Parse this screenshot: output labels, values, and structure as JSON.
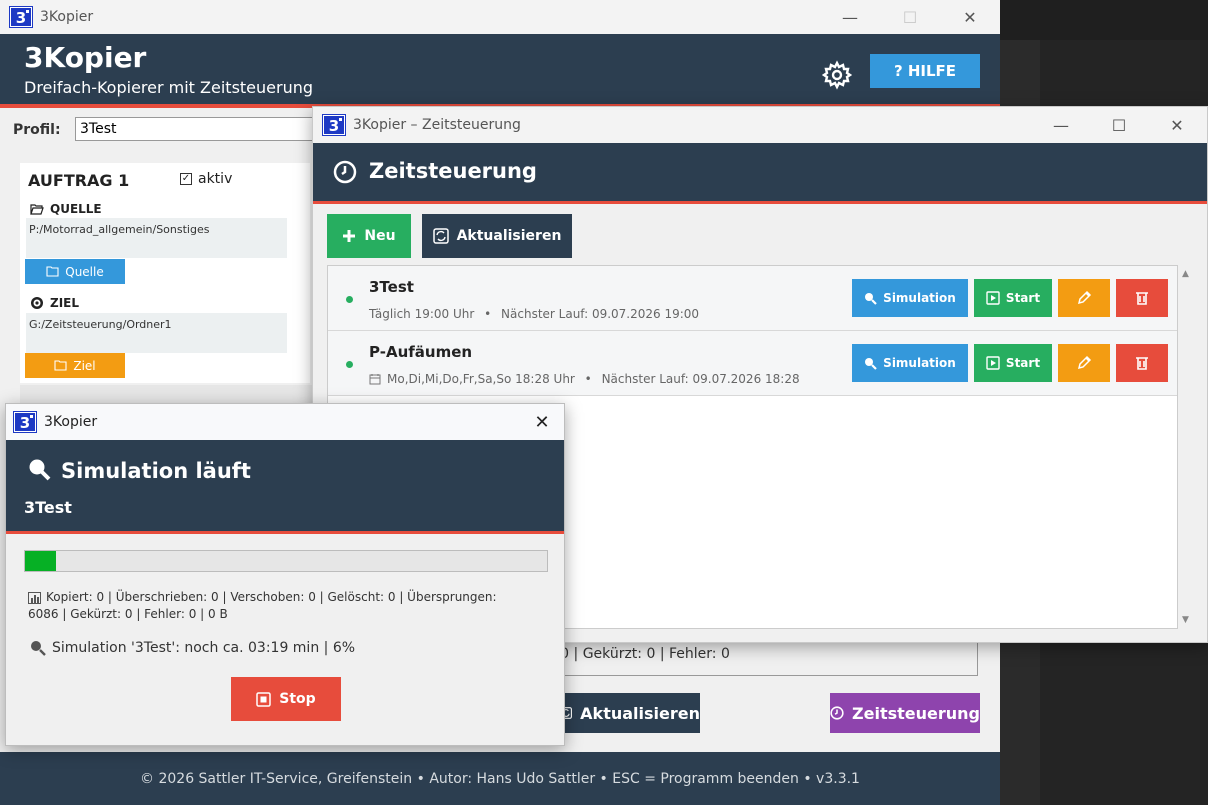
{
  "main_window": {
    "title": "3Kopier",
    "app_title": "3Kopier",
    "subtitle": "Dreifach-Kopierer mit Zeitsteuerung",
    "help_label": "? HILFE",
    "profile_label": "Profil:",
    "profile_value": "3Test",
    "job": {
      "title": "AUFTRAG 1",
      "active_label": "aktiv",
      "active_checked": true,
      "source_label": "QUELLE",
      "source_path": "P:/Motorrad_allgemein/Sonstiges",
      "source_button": "Quelle",
      "target_label": "ZIEL",
      "target_path": "G:/Zeitsteuerung/Ordner1",
      "target_button": "Ziel"
    },
    "stats_partial": ": 0  |  Gekürzt: 0  |  Fehler: 0",
    "refresh_label": "Aktualisieren",
    "schedule_label": "Zeitsteuerung",
    "footer": "© 2026 Sattler IT-Service, Greifenstein  •  Autor: Hans Udo Sattler  •  ESC = Programm beenden  •  v3.3.1"
  },
  "schedule_window": {
    "title": "3Kopier – Zeitsteuerung",
    "header": "Zeitsteuerung",
    "new_label": "Neu",
    "refresh_label": "Aktualisieren",
    "entries": [
      {
        "name": "3Test",
        "schedule": "Täglich 19:00 Uhr",
        "next_run": "Nächster Lauf: 09.07.2026 19:00",
        "simulation_label": "Simulation",
        "start_label": "Start"
      },
      {
        "name": "P-Aufäumen",
        "schedule": "Mo,Di,Mi,Do,Fr,Sa,So 18:28 Uhr",
        "next_run": "Nächster Lauf: 09.07.2026 18:28",
        "simulation_label": "Simulation",
        "start_label": "Start"
      }
    ]
  },
  "simulation_dialog": {
    "title": "3Kopier",
    "header": "Simulation läuft",
    "job_name": "3Test",
    "progress_percent": 6,
    "stats_line1": "Kopiert: 0  |  Überschrieben: 0  |  Verschoben: 0  |  Gelöscht: 0  |  Übersprungen:",
    "stats_line2": "6086  |  Gekürzt: 0  |  Fehler: 0  |  0 B",
    "status": "Simulation '3Test': noch ca. 03:19 min | 6%",
    "stop_label": "Stop"
  },
  "colors": {
    "header_bg": "#2c3e50",
    "accent_red": "#e74c3c",
    "blue": "#3498db",
    "green": "#27ae60",
    "orange": "#f39c12",
    "purple": "#8e44ad",
    "progress": "#06b025"
  }
}
